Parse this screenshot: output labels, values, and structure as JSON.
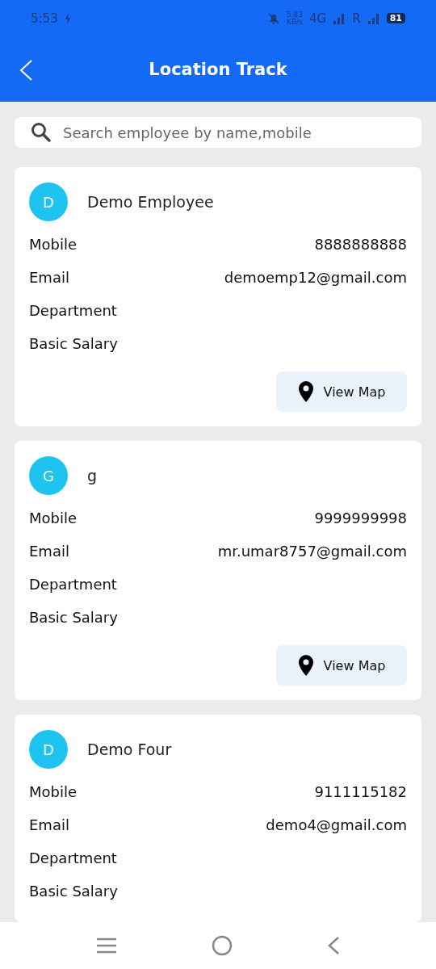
{
  "status_bar": {
    "time": "5:53",
    "speed": "5.83",
    "speed_unit": "KB/s",
    "network": "4G",
    "roaming": "R",
    "battery": "81"
  },
  "header": {
    "title": "Location Track"
  },
  "search": {
    "placeholder": "Search employee by name,mobile"
  },
  "employees": [
    {
      "initial": "D",
      "name": "Demo Employee",
      "fields": [
        {
          "label": "Mobile",
          "value": "8888888888"
        },
        {
          "label": "Email",
          "value": "demoemp12@gmail.com"
        },
        {
          "label": "Department"
        },
        {
          "label": "Basic Salary"
        }
      ],
      "button": "View Map"
    },
    {
      "initial": "G",
      "name": "g",
      "fields": [
        {
          "label": "Mobile",
          "value": "9999999998"
        },
        {
          "label": "Email",
          "value": "mr.umar8757@gmail.com"
        },
        {
          "label": "Department"
        },
        {
          "label": "Basic Salary"
        }
      ],
      "button": "View Map"
    },
    {
      "initial": "D",
      "name": "Demo Four",
      "fields": [
        {
          "label": "Mobile",
          "value": "9111115182"
        },
        {
          "label": "Email",
          "value": "demo4@gmail.com"
        },
        {
          "label": "Department"
        },
        {
          "label": "Basic Salary"
        }
      ]
    }
  ]
}
